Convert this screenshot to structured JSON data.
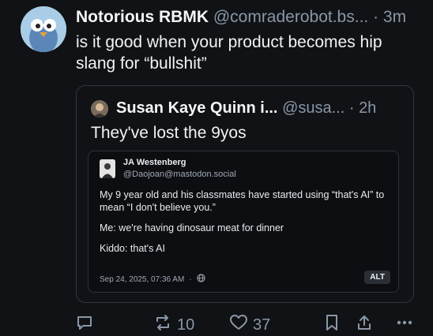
{
  "post": {
    "author_name": "Notorious RBMK",
    "author_handle": "@comraderobot.bs...",
    "separator": " · ",
    "time": "3m",
    "text": "is it good when your product becomes hip slang for “bullshit”"
  },
  "quote": {
    "author_name": "Susan Kaye Quinn i...",
    "author_handle": "@susa...",
    "separator": " · ",
    "time": "2h",
    "text": "They've lost the 9yos"
  },
  "embedded": {
    "author_name": "JA Westenberg",
    "author_handle": "@Daojoan@mastodon.social",
    "paragraphs": [
      "My 9 year old and his classmates have started using “that's AI” to mean “I don't believe you.”",
      "Me: we're having dinosaur meat for dinner",
      "Kiddo: that's AI"
    ],
    "timestamp": "Sep 24, 2025, 07:36 AM",
    "dot": "·",
    "alt_label": "ALT"
  },
  "actions": {
    "repost_count": "10",
    "like_count": "37"
  },
  "icons": {
    "reply": "reply-icon",
    "repost": "repost-icon",
    "like": "heart-icon",
    "bookmark": "bookmark-icon",
    "share": "share-icon",
    "more": "more-icon",
    "globe": "globe-icon"
  }
}
